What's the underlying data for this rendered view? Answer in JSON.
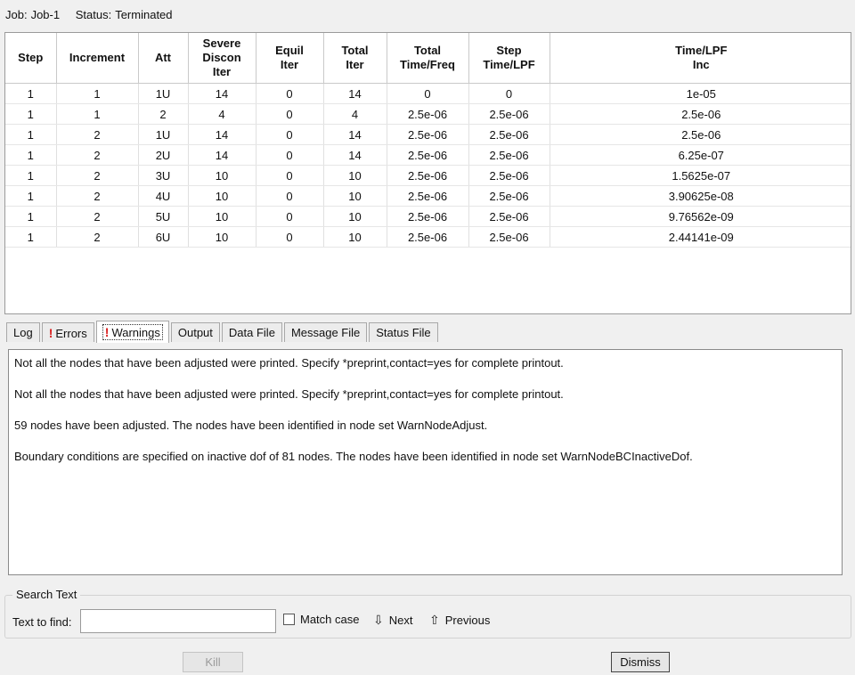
{
  "job": {
    "job_label": "Job:",
    "job_value": "Job-1",
    "status_label": "Status:",
    "status_value": "Terminated"
  },
  "table": {
    "headers": [
      [
        "Step"
      ],
      [
        "Increment"
      ],
      [
        "Att"
      ],
      [
        "Severe",
        "Discon",
        "Iter"
      ],
      [
        "Equil",
        "Iter"
      ],
      [
        "Total",
        "Iter"
      ],
      [
        "Total",
        "Time/Freq"
      ],
      [
        "Step",
        "Time/LPF"
      ],
      [
        "Time/LPF",
        "Inc"
      ]
    ],
    "rows": [
      [
        "1",
        "1",
        "1U",
        "14",
        "0",
        "14",
        "0",
        "0",
        "1e-05"
      ],
      [
        "1",
        "1",
        "2",
        "4",
        "0",
        "4",
        "2.5e-06",
        "2.5e-06",
        "2.5e-06"
      ],
      [
        "1",
        "2",
        "1U",
        "14",
        "0",
        "14",
        "2.5e-06",
        "2.5e-06",
        "2.5e-06"
      ],
      [
        "1",
        "2",
        "2U",
        "14",
        "0",
        "14",
        "2.5e-06",
        "2.5e-06",
        "6.25e-07"
      ],
      [
        "1",
        "2",
        "3U",
        "10",
        "0",
        "10",
        "2.5e-06",
        "2.5e-06",
        "1.5625e-07"
      ],
      [
        "1",
        "2",
        "4U",
        "10",
        "0",
        "10",
        "2.5e-06",
        "2.5e-06",
        "3.90625e-08"
      ],
      [
        "1",
        "2",
        "5U",
        "10",
        "0",
        "10",
        "2.5e-06",
        "2.5e-06",
        "9.76562e-09"
      ],
      [
        "1",
        "2",
        "6U",
        "10",
        "0",
        "10",
        "2.5e-06",
        "2.5e-06",
        "2.44141e-09"
      ]
    ]
  },
  "tabs": [
    {
      "label": "Log",
      "alert": false,
      "active": false
    },
    {
      "label": "Errors",
      "alert": true,
      "active": false
    },
    {
      "label": "Warnings",
      "alert": true,
      "active": true
    },
    {
      "label": "Output",
      "alert": false,
      "active": false
    },
    {
      "label": "Data File",
      "alert": false,
      "active": false
    },
    {
      "label": "Message File",
      "alert": false,
      "active": false
    },
    {
      "label": "Status File",
      "alert": false,
      "active": false
    }
  ],
  "alert_mark": "!",
  "messages": [
    "Not all the nodes that have been adjusted were printed. Specify *preprint,contact=yes for complete printout.",
    "Not all the nodes that have been adjusted were printed. Specify *preprint,contact=yes for complete printout.",
    "59 nodes have been adjusted. The nodes have been identified in node set WarnNodeAdjust.",
    "Boundary conditions are specified on inactive dof of 81 nodes. The nodes have been identified in node set WarnNodeBCInactiveDof."
  ],
  "search": {
    "group_label": "Search Text",
    "find_label": "Text to find:",
    "find_value": "",
    "match_case_label": "Match case",
    "next_label": "Next",
    "previous_label": "Previous",
    "next_icon": "arrow-down-icon",
    "previous_icon": "arrow-up-icon"
  },
  "buttons": {
    "kill_label": "Kill",
    "dismiss_label": "Dismiss"
  },
  "colors": {
    "alert": "#d81b1b",
    "disabled_text": "#9a9a9a"
  }
}
